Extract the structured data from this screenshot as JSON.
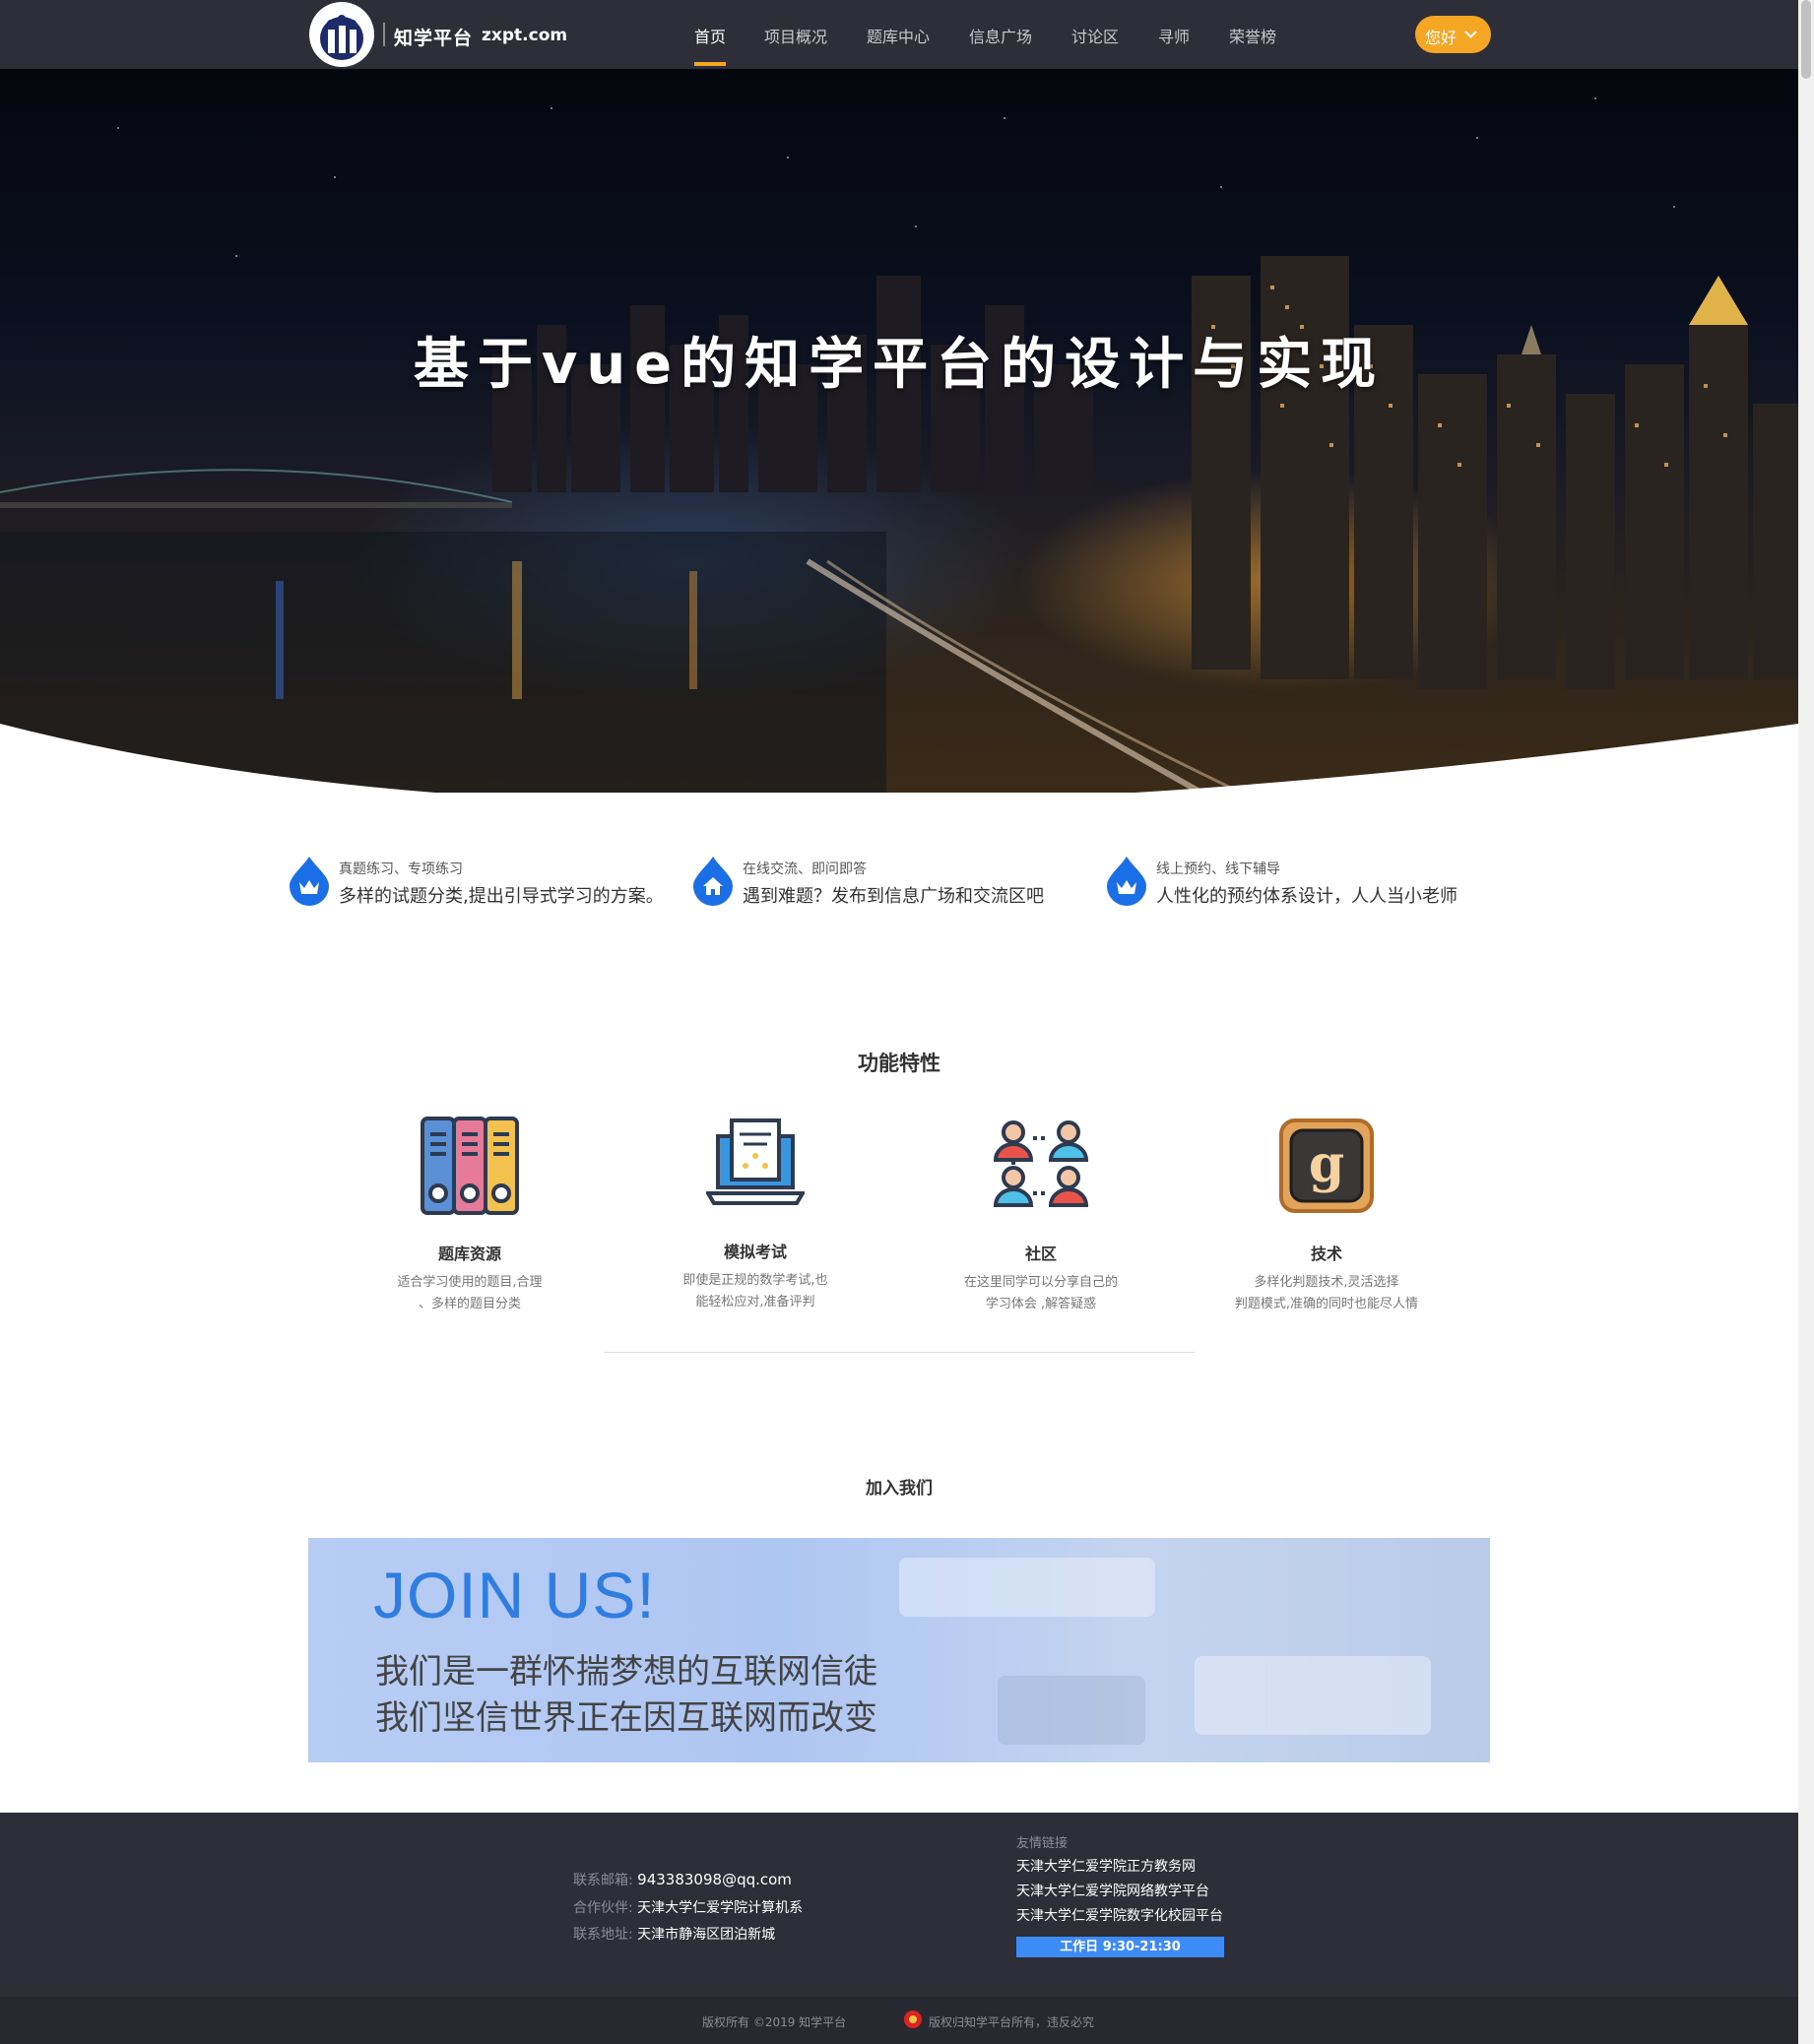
{
  "nav": {
    "brand": "知学平台",
    "domain": "zxpt.com",
    "items": [
      "首页",
      "项目概况",
      "题库中心",
      "信息广场",
      "讨论区",
      "寻师",
      "荣誉榜"
    ],
    "active_item": "首页",
    "user_button": "您好",
    "accent_color": "#f5a623"
  },
  "hero": {
    "title": "基于vue的知学平台的设计与实现"
  },
  "highlights": [
    {
      "icon": "crown-drop-icon",
      "small": "真题练习、专项练习",
      "big": "多样的试题分类,提出引导式学习的方案。"
    },
    {
      "icon": "house-drop-icon",
      "small": "在线交流、即问即答",
      "big": "遇到难题？发布到信息广场和交流区吧"
    },
    {
      "icon": "crown-drop-icon",
      "small": "线上预约、线下辅导",
      "big": "人性化的预约体系设计，人人当小老师"
    }
  ],
  "features": {
    "title": "功能特性",
    "cards": [
      {
        "icon": "binders-icon",
        "title": "题库资源",
        "desc_1": "适合学习使用的题目,合理",
        "desc_2": "、多样的题目分类"
      },
      {
        "icon": "laptop-exam-icon",
        "title": "模拟考试",
        "desc_1": "即使是正规的数学考试,也",
        "desc_2": "能轻松应对,准备评判"
      },
      {
        "icon": "community-icon",
        "title": "社区",
        "desc_1": "在这里同学可以分享自己的",
        "desc_2": "学习体会 ,解答疑惑"
      },
      {
        "icon": "tech-g-icon",
        "title": "技术",
        "desc_1": "多样化判题技术,灵活选择",
        "desc_2": "判题模式,准确的同时也能尽人情"
      }
    ]
  },
  "join": {
    "title": "加入我们",
    "banner_big": "JOIN US!",
    "banner_line1": "我们是一群怀揣梦想的互联网信徒",
    "banner_line2": "我们坚信世界正在因互联网而改变"
  },
  "footer": {
    "email_label": "联系邮箱:",
    "email": "943383098@qq.com",
    "partner_label": "合作伙伴:",
    "partner": "天津大学仁爱学院计算机系",
    "address_label": "联系地址:",
    "address": "天津市静海区团泊新城",
    "links_title": "友情链接",
    "links": [
      "天津大学仁爱学院正方教务网",
      "天津大学仁爱学院网络教学平台",
      "天津大学仁爱学院数字化校园平台"
    ],
    "workday": "工作日 9:30-21:30",
    "copyright": "版权所有 ©2019 知学平台",
    "rights": "版权归知学平台所有，违反必究"
  }
}
